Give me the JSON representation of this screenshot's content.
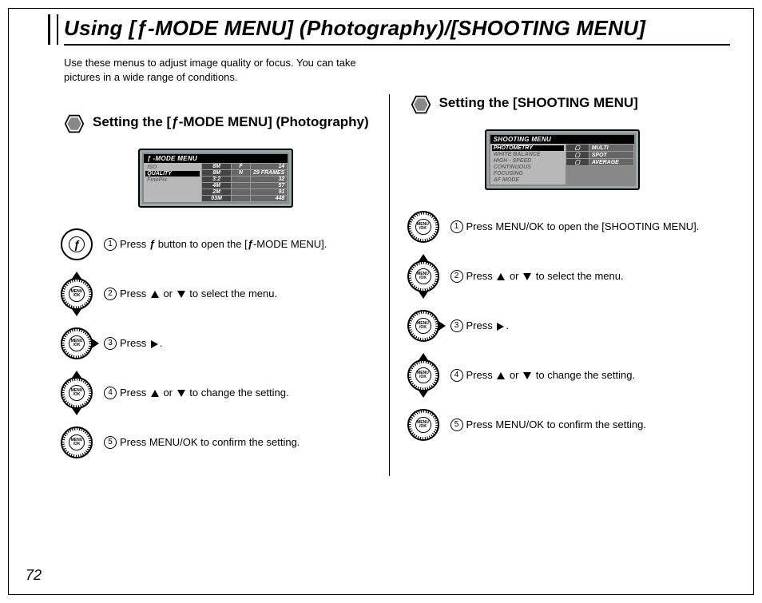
{
  "page_number": "72",
  "title_pre": "Using [",
  "title_mid": "-MODE MENU] (Photography)/[SHOOTING MENU]",
  "intro": "Use these menus to adjust image quality or focus. You can take pictures in a wide range of conditions.",
  "left": {
    "heading_pre": "Setting the [",
    "heading_post": "-MODE MENU] (Photography)",
    "lcd_header": "-MODE MENU",
    "lcd_left_items": [
      "ISO",
      "QUALITY",
      "FinePix"
    ],
    "lcd_active_index": 1,
    "lcd_rows": [
      {
        "k": "8M",
        "m": "F",
        "v": "14"
      },
      {
        "k": "8M",
        "m": "N",
        "v": "29 FRAMES"
      },
      {
        "k": "3:2",
        "m": "",
        "v": "32"
      },
      {
        "k": "4M",
        "m": "",
        "v": "57"
      },
      {
        "k": "2M",
        "m": "",
        "v": "91"
      },
      {
        "k": "03M",
        "m": "",
        "v": "448"
      }
    ],
    "steps": [
      {
        "icon": "f",
        "pre": "Press ",
        "mid": " button to open the [",
        "post": "-MODE MENU]."
      },
      {
        "icon": "updown",
        "pre": "Press ",
        "mid": " or ",
        "post": " to select the menu."
      },
      {
        "icon": "right",
        "pre": "Press ",
        "post": "."
      },
      {
        "icon": "updown",
        "pre": "Press ",
        "mid": " or ",
        "post": " to change the setting."
      },
      {
        "icon": "plain",
        "pre": "Press MENU/OK to confirm the setting."
      }
    ]
  },
  "right": {
    "heading": "Setting the [SHOOTING MENU]",
    "lcd_header": "SHOOTING MENU",
    "lcd_left_items": [
      "PHOTOMETRY",
      "WHITE BALANCE",
      "HIGH - SPEED",
      "CONTINUOUS",
      "FOCUSING",
      "AF MODE"
    ],
    "lcd_active_index": 0,
    "lcd_right_items": [
      "MULTI",
      "SPOT",
      "AVERAGE"
    ],
    "steps": [
      {
        "icon": "plain",
        "pre": "Press MENU/OK to open the [SHOOTING MENU]."
      },
      {
        "icon": "updown",
        "pre": "Press ",
        "mid": " or ",
        "post": " to select the menu."
      },
      {
        "icon": "right",
        "pre": "Press ",
        "post": "."
      },
      {
        "icon": "updown",
        "pre": "Press ",
        "mid": " or ",
        "post": " to change the setting."
      },
      {
        "icon": "plain",
        "pre": "Press MENU/OK to confirm the setting."
      }
    ]
  }
}
